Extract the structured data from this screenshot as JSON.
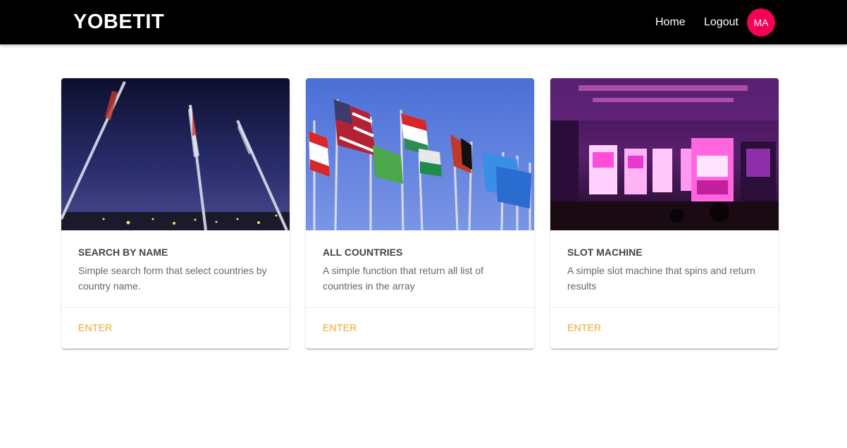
{
  "navbar": {
    "brand": "YOBETIT",
    "links": [
      "Home",
      "Logout"
    ],
    "avatar_initials": "MA",
    "avatar_color": "#f50057"
  },
  "cards": [
    {
      "title": "SEARCH BY NAME",
      "description": "Simple search form that select countries by country name.",
      "action": "ENTER",
      "image": "flagpoles-night-image"
    },
    {
      "title": "ALL COUNTRIES",
      "description": "A simple function that return all list of countries in the array",
      "action": "ENTER",
      "image": "world-flags-image"
    },
    {
      "title": "SLOT MACHINE",
      "description": "A simple slot machine that spins and return results",
      "action": "ENTER",
      "image": "casino-slot-machines-image"
    }
  ],
  "colors": {
    "navbar_bg": "#000000",
    "action_text": "#f5a623"
  }
}
